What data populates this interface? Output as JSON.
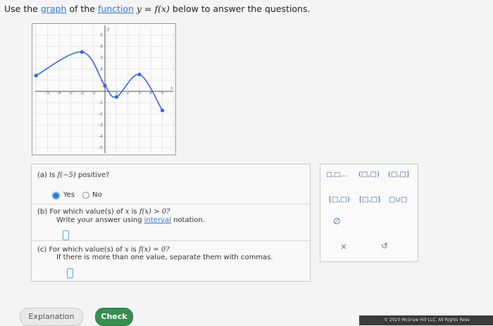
{
  "instruction": {
    "prefix": "Use the",
    "graph_link": "graph",
    "middle": "of the",
    "function_link": "function",
    "math": "y = f(x)",
    "suffix": "below to answer the questions."
  },
  "graph": {
    "x_ticks": [
      "-5",
      "-4",
      "-3",
      "-2",
      "-1",
      "1",
      "2",
      "3",
      "4",
      "5"
    ],
    "y_ticks": [
      "5",
      "4",
      "3",
      "2",
      "1",
      "-1",
      "-2",
      "-3",
      "-4",
      "-5"
    ],
    "x_axis_label": "x",
    "y_axis_label": "y",
    "key_points": [
      {
        "x": -6,
        "y": 1.4
      },
      {
        "x": -2,
        "y": 3.5
      },
      {
        "x": 0,
        "y": 0.5
      },
      {
        "x": 1,
        "y": -0.5
      },
      {
        "x": 3,
        "y": 1.5
      },
      {
        "x": 5,
        "y": -1.7
      }
    ]
  },
  "questions": {
    "a": {
      "label": "(a)",
      "text_before": "Is",
      "math": "f(−5)",
      "text_after": "positive?",
      "option_yes": "Yes",
      "option_no": "No",
      "selected": "Yes"
    },
    "b": {
      "label": "(b)",
      "text_before": "For which value(s) of",
      "math": "x",
      "text_mid": "is",
      "math2": "f(x) > 0?",
      "line2_before": "Write your answer using",
      "line2_link": "interval",
      "line2_after": "notation."
    },
    "c": {
      "label": "(c)",
      "text_before": "For which value(s) of",
      "math": "x",
      "text_mid": "is",
      "math2": "f(x) = 0?",
      "line2": "If there is more than one value, separate them with commas."
    }
  },
  "palette": {
    "b1": "□,□,...",
    "b2": "(□,□)",
    "b3": "(□,□]",
    "b4": "[□,□)",
    "b5": "[□,□]",
    "b6": "□∪□",
    "b7": "∅",
    "clear": "×",
    "undo": "↺"
  },
  "buttons": {
    "explanation": "Explanation",
    "check": "Check"
  },
  "footer": {
    "copyright": "© 2023 McGraw Hill LLC. All Rights Rese"
  }
}
